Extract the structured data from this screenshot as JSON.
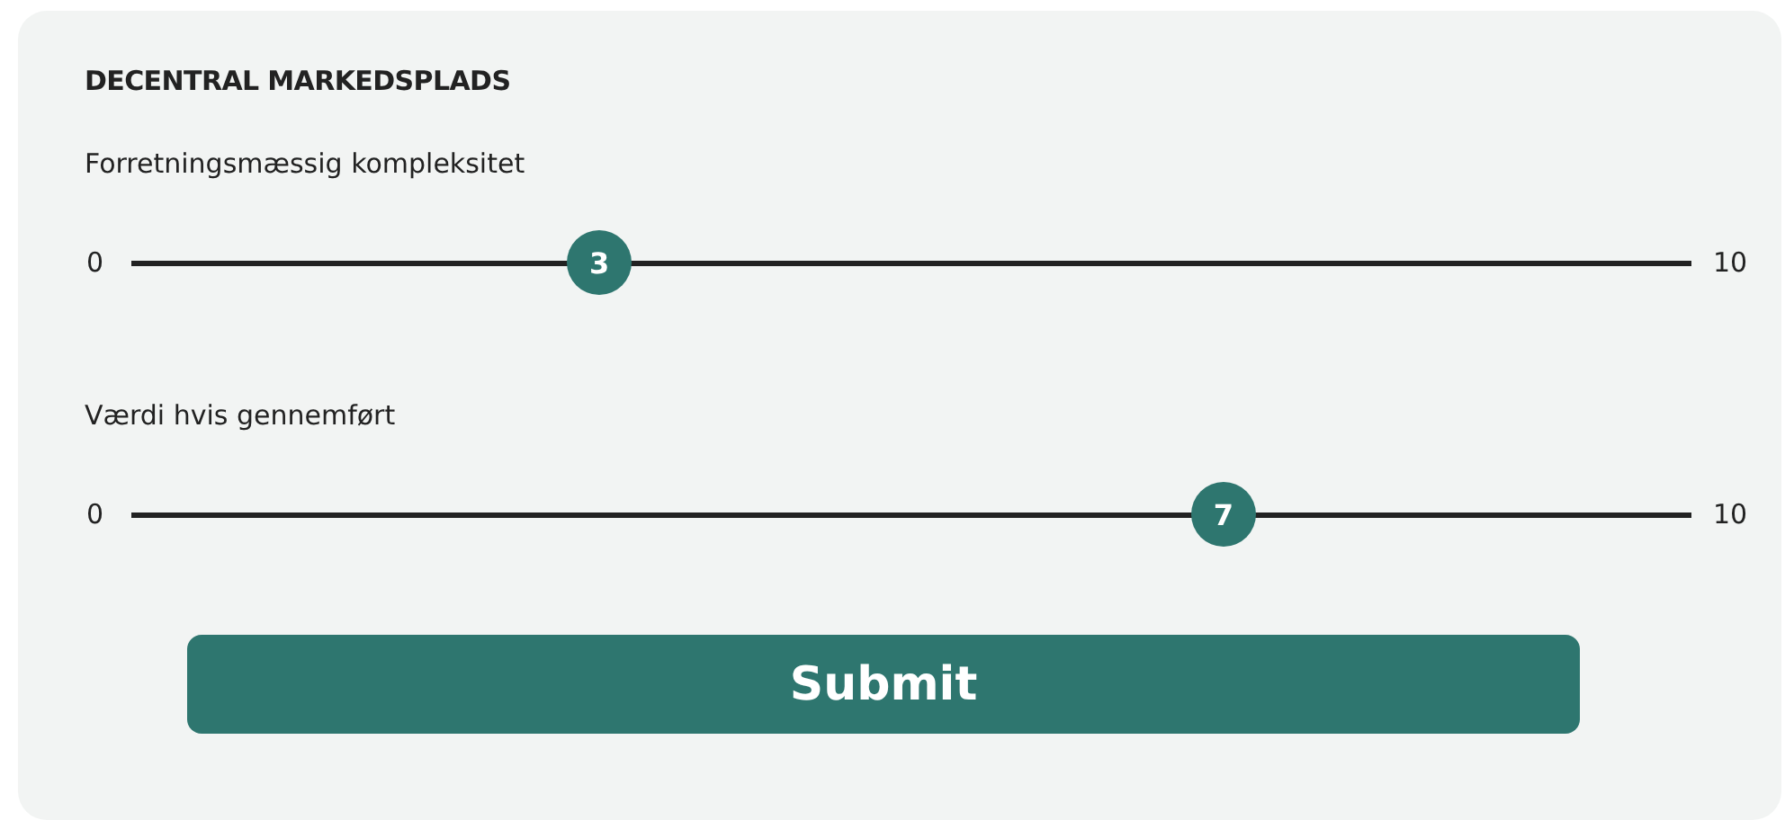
{
  "title": "DECENTRAL MARKEDSPLADS",
  "sliders": [
    {
      "label": "Forretningsmæssig kompleksitet",
      "min": "0",
      "max": "10",
      "value": "3",
      "level": 0.3
    },
    {
      "label": "Værdi hvis gennemført",
      "min": "0",
      "max": "10",
      "value": "7",
      "level": 0.7
    }
  ],
  "button": "Submit"
}
